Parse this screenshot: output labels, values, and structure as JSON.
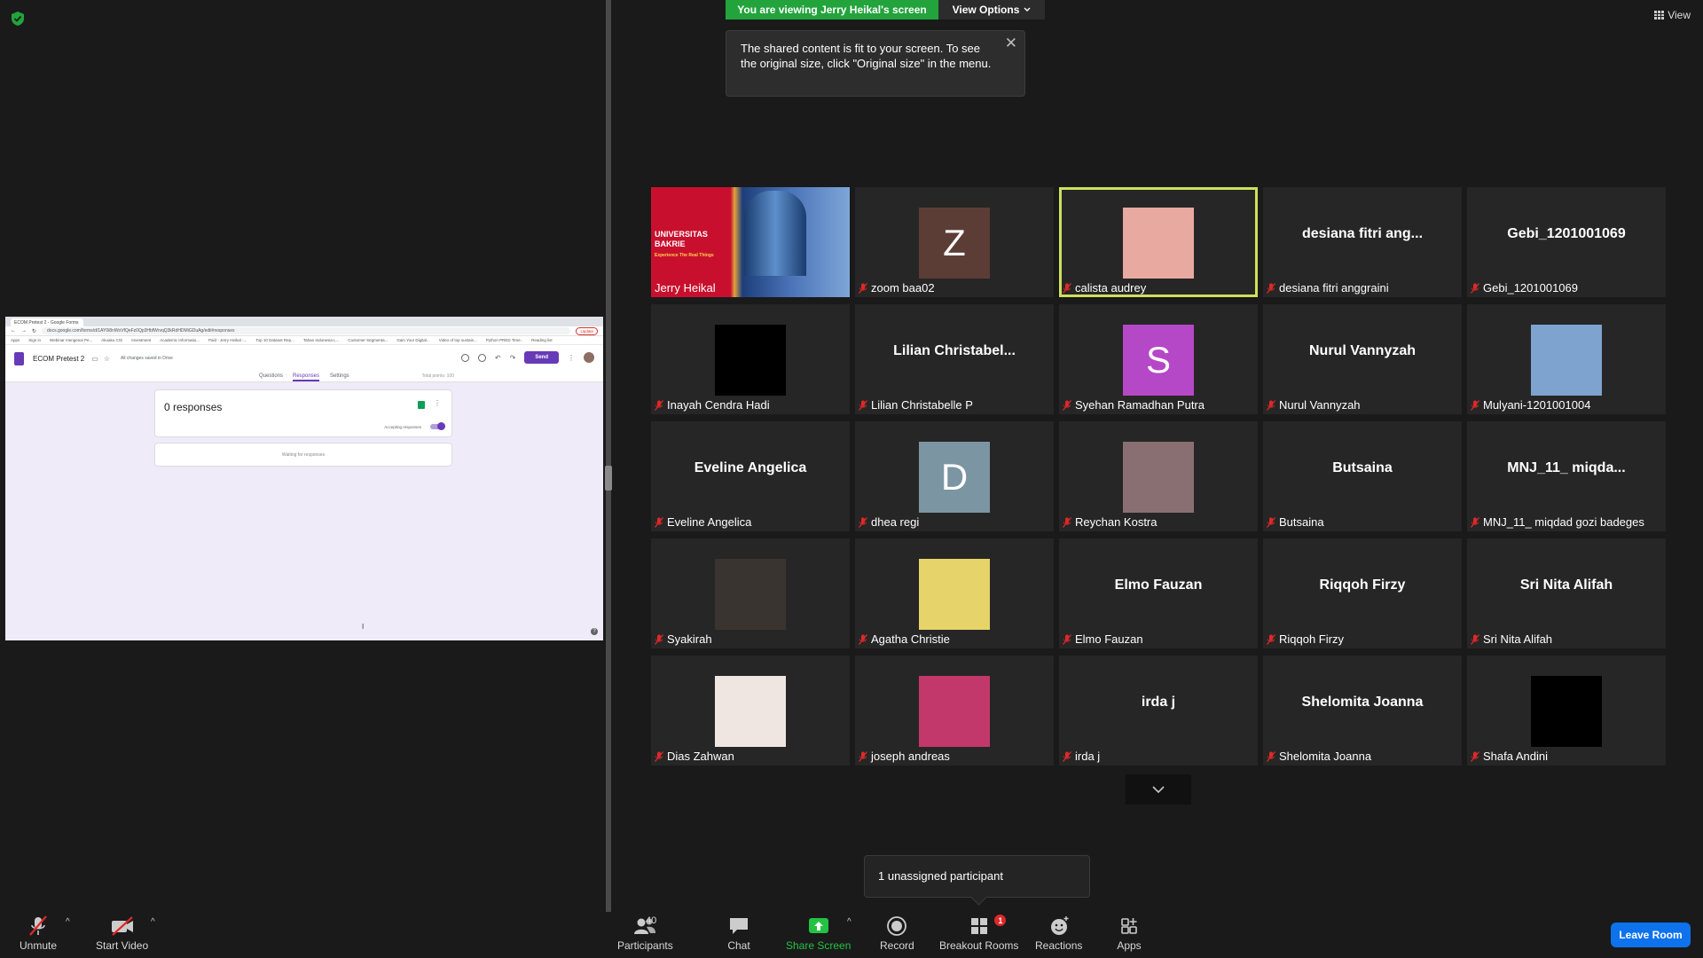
{
  "banner": {
    "viewing_text": "You are viewing Jerry Heikal's screen",
    "view_options_label": "View Options",
    "tooltip_text": "The shared content is fit to your screen. To see the original size, click \"Original size\" in the menu.",
    "view_label": "View"
  },
  "shared_screen": {
    "browser_tab": "ECOM Pretest 2 - Google Forms",
    "url": "docs.google.com/forms/d/1AY0i8nWoVfQeFz0Qp3HbfWrvqQ3kRdHDMiGDuAg/edit#responses",
    "update_label": "Update",
    "bookmarks": [
      "Apps",
      "Sign in",
      "Webinar mengenai Pe...",
      "Akuaku CGi",
      "Investment",
      "Academic Informatio...",
      "Paid - Jerry Heikal -...",
      "Top 10 Dataset Rep...",
      "Tahan Indonesia L...",
      "Customer Segmenta...",
      "Gain Your Digital...",
      "Video of top sustain...",
      "Python PRED Time..",
      "Reading list"
    ],
    "form_title": "ECOM Pretest 2",
    "saved_text": "All changes saved in Drive",
    "send_label": "Send",
    "tabs": [
      "Questions",
      "Responses",
      "Settings"
    ],
    "total_points": "Total points: 100",
    "responses_count": "0 responses",
    "accepting_label": "Accepting responses",
    "waiting_label": "Waiting for responses"
  },
  "participants": [
    {
      "name": "Jerry Heikal",
      "muted": false,
      "kind": "host"
    },
    {
      "name": "zoom baa02",
      "muted": true,
      "kind": "letter",
      "letter": "Z",
      "color": "#5b3d35"
    },
    {
      "name": "calista audrey",
      "muted": true,
      "kind": "photo",
      "speaking": true,
      "color": "#e8a9a0"
    },
    {
      "name": "desiana fitri anggraini",
      "muted": true,
      "kind": "text",
      "display": "desiana  fitri  ang..."
    },
    {
      "name": "Gebi_1201001069",
      "muted": true,
      "kind": "text",
      "display": "Gebi_1201001069"
    },
    {
      "name": "Inayah Cendra Hadi",
      "muted": true,
      "kind": "photo",
      "color": "#000000"
    },
    {
      "name": "Lilian Christabelle P",
      "muted": true,
      "kind": "text",
      "display": "Lilian  Christabel..."
    },
    {
      "name": "Syehan Ramadhan Putra",
      "muted": true,
      "kind": "letter",
      "letter": "S",
      "color": "#b548c6"
    },
    {
      "name": "Nurul Vannyzah",
      "muted": true,
      "kind": "text",
      "display": "Nurul Vannyzah"
    },
    {
      "name": "Mulyani-1201001004",
      "muted": true,
      "kind": "photo",
      "color": "#7ea3cf"
    },
    {
      "name": "Eveline Angelica",
      "muted": true,
      "kind": "text",
      "display": "Eveline Angelica"
    },
    {
      "name": "dhea regi",
      "muted": true,
      "kind": "letter",
      "letter": "D",
      "color": "#7c95a3"
    },
    {
      "name": "Reychan Kostra",
      "muted": true,
      "kind": "photo",
      "color": "#8a6f72"
    },
    {
      "name": "Butsaina",
      "muted": true,
      "kind": "text",
      "display": "Butsaina"
    },
    {
      "name": "MNJ_11_ miqdad gozi badeges",
      "muted": true,
      "kind": "text",
      "display": "MNJ_11_  miqda..."
    },
    {
      "name": "Syakirah",
      "muted": true,
      "kind": "photo",
      "color": "#3a3430"
    },
    {
      "name": "Agatha Christie",
      "muted": true,
      "kind": "photo",
      "color": "#e6d46a"
    },
    {
      "name": "Elmo Fauzan",
      "muted": true,
      "kind": "text",
      "display": "Elmo Fauzan"
    },
    {
      "name": "Riqqoh Firzy",
      "muted": true,
      "kind": "text",
      "display": "Riqqoh Firzy"
    },
    {
      "name": "Sri Nita Alifah",
      "muted": true,
      "kind": "text",
      "display": "Sri Nita Alifah"
    },
    {
      "name": "Dias Zahwan",
      "muted": true,
      "kind": "photo",
      "color": "#efe6e2"
    },
    {
      "name": "joseph andreas",
      "muted": true,
      "kind": "photo",
      "color": "#c2386a"
    },
    {
      "name": "irda j",
      "muted": true,
      "kind": "text",
      "display": "irda j"
    },
    {
      "name": "Shelomita Joanna",
      "muted": true,
      "kind": "text",
      "display": "Shelomita Joanna"
    },
    {
      "name": "Shafa Andini",
      "muted": true,
      "kind": "photo",
      "color": "#000000"
    }
  ],
  "unassigned_text": "1 unassigned participant",
  "toolbar": {
    "unmute": "Unmute",
    "start_video": "Start Video",
    "participants": "Participants",
    "participants_count": "40",
    "chat": "Chat",
    "share_screen": "Share Screen",
    "record": "Record",
    "breakout_rooms": "Breakout Rooms",
    "breakout_badge": "1",
    "reactions": "Reactions",
    "apps": "Apps",
    "leave": "Leave Room"
  },
  "colors": {
    "banner_green": "#23a33c",
    "speaking_border": "#cfe05a",
    "leave_blue": "#0e72ed",
    "mute_red": "#e02828",
    "forms_purple": "#673ab7"
  }
}
